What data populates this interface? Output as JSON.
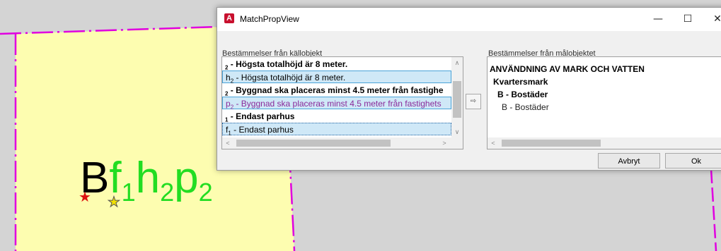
{
  "window": {
    "title": "MatchPropView",
    "app_icon": "A",
    "minimize": "—",
    "maximize": "☐",
    "close": "✕"
  },
  "source": {
    "label": "Bestämmelser från källobjekt",
    "items": [
      {
        "pre": "",
        "sub": "2",
        "text": " - Högsta totalhöjd är 8 meter.",
        "style": "bold"
      },
      {
        "pre": "h",
        "sub": "2",
        "text": " - Högsta totalhöjd är 8 meter.",
        "style": "sel"
      },
      {
        "pre": "",
        "sub": "2",
        "text": " - Byggnad ska placeras minst 4.5 meter från fastighe",
        "style": "bold"
      },
      {
        "pre": "p",
        "sub": "2",
        "text": " - Byggnad ska placeras minst 4.5 meter från fastighets",
        "style": "sel purple"
      },
      {
        "pre": "",
        "sub": "1",
        "text": " - Endast parhus",
        "style": "bold"
      },
      {
        "pre": "f",
        "sub": "1",
        "text": " - Endast parhus",
        "style": "dotted"
      }
    ]
  },
  "target": {
    "label": "Bestämmelser från målobjektet",
    "items": [
      "ANVÄNDNING AV MARK OCH VATTEN",
      "Kvartersmark",
      "B - Bostäder",
      "B - Bostäder"
    ]
  },
  "buttons": {
    "transfer": "⇨",
    "cancel": "Avbryt",
    "ok": "Ok"
  },
  "scroll": {
    "up": "∧",
    "down": "∨",
    "left": "<",
    "right": ">"
  },
  "map_label": {
    "main": "B",
    "codes": [
      {
        "letter": "f",
        "sub": "1"
      },
      {
        "letter": "h",
        "sub": "2"
      },
      {
        "letter": "p",
        "sub": "2"
      }
    ]
  },
  "colors": {
    "parcel_fill": "#fdfdb0",
    "boundary": "#e000e0",
    "label_green": "#22dd22",
    "selection": "#cfe8f7"
  }
}
